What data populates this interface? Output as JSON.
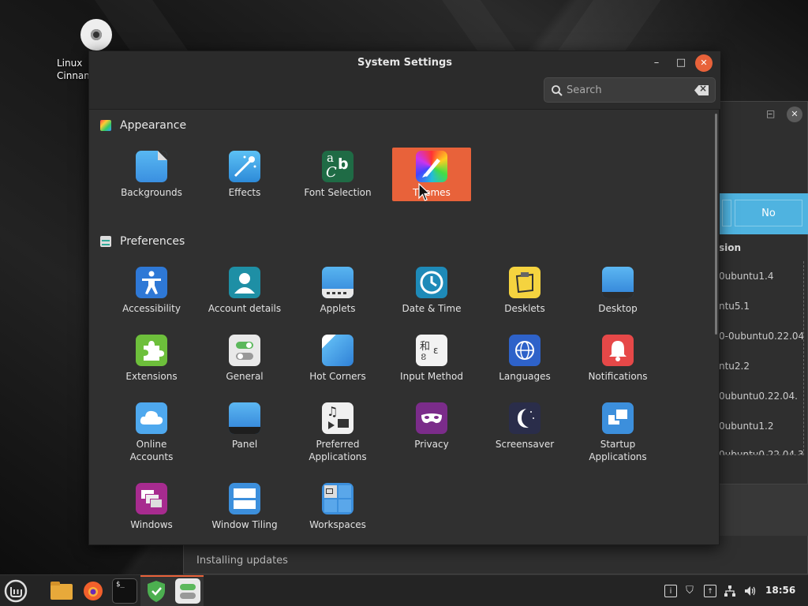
{
  "desktop": {
    "icon_label_1": "Linux",
    "icon_label_2": "Cinnamon"
  },
  "background_window": {
    "min": "–",
    "max": "□",
    "close": "✕",
    "no_button": "No",
    "column_header": "sion",
    "versions": [
      "0ubuntu1.4",
      "ntu5.1",
      "0-0ubuntu0.22.04",
      "ntu2.2",
      "0ubuntu0.22.04.",
      "0ubuntu1.2",
      "0ubuntu0.22.04.3"
    ],
    "status": "Installing updates"
  },
  "window": {
    "title": "System Settings",
    "min": "–",
    "max": "□",
    "close": "✕",
    "search_placeholder": "Search"
  },
  "sections": {
    "appearance": {
      "title": "Appearance",
      "items": [
        "Backgrounds",
        "Effects",
        "Font Selection",
        "Themes"
      ]
    },
    "preferences": {
      "title": "Preferences",
      "items": [
        "Accessibility",
        "Account details",
        "Applets",
        "Date & Time",
        "Desklets",
        "Desktop",
        "Extensions",
        "General",
        "Hot Corners",
        "Input Method",
        "Languages",
        "Notifications",
        "Online\nAccounts",
        "Panel",
        "Preferred\nApplications",
        "Privacy",
        "Screensaver",
        "Startup\nApplications",
        "Windows",
        "Window Tiling",
        "Workspaces"
      ]
    }
  },
  "icons": {
    "font_selection": "a b C",
    "input_method": "和 ខ ε",
    "accessibility": "figure",
    "date_time": "clock"
  },
  "taskbar": {
    "clock": "18:56"
  },
  "colors": {
    "accent": "#e8623a",
    "highlight_blue": "#4fb3e0"
  }
}
